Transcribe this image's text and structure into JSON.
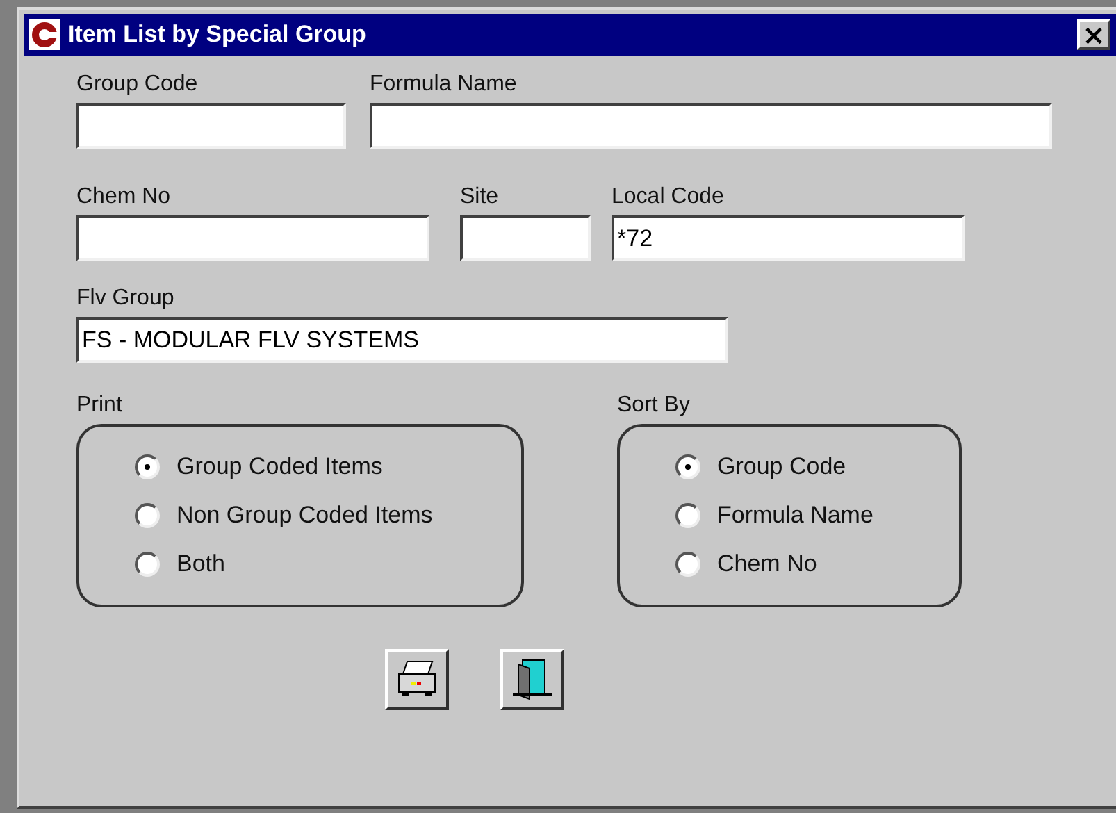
{
  "window": {
    "title": "Item List by Special Group",
    "close": "×"
  },
  "fields": [
    {
      "label": "Group Code"
    },
    {
      "label": "Formula Name"
    },
    {
      "label": "Chem No"
    },
    {
      "label": "Site"
    },
    {
      "label": "Local Code",
      "value": "*72"
    },
    {
      "label": "Flv Group",
      "value": "FS - MODULAR FLV SYSTEMS"
    }
  ],
  "print": {
    "label": "Print",
    "options": [
      {
        "label": "Group Coded Items",
        "selected": true
      },
      {
        "label": "Non Group Coded Items",
        "selected": false
      },
      {
        "label": "Both",
        "selected": false
      }
    ]
  },
  "sort_by": {
    "label": "Sort By",
    "options": [
      {
        "label": "Group Code",
        "selected": true
      },
      {
        "label": "Formula Name",
        "selected": false
      },
      {
        "label": "Chem No",
        "selected": false
      }
    ]
  }
}
